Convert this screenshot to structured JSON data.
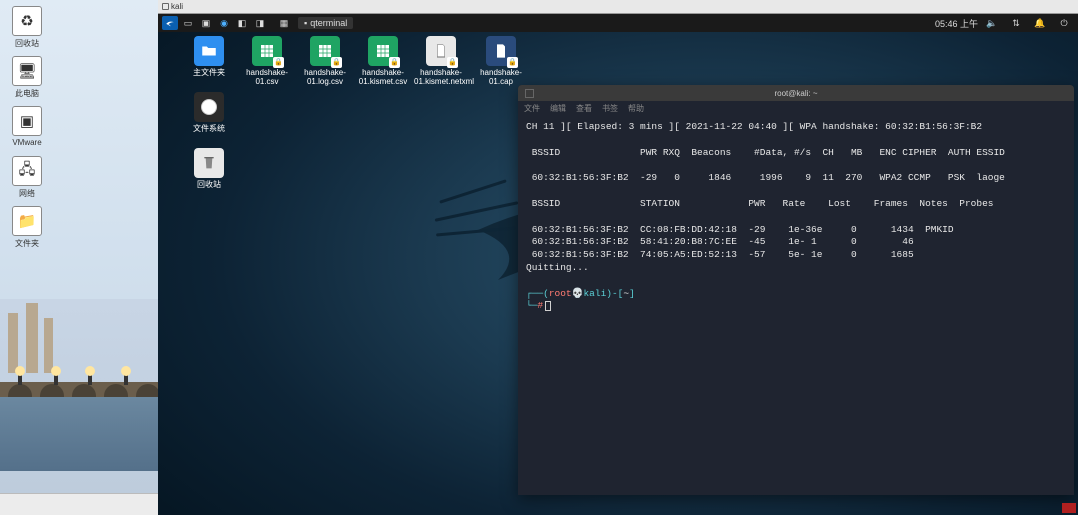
{
  "host": {
    "icons": [
      {
        "label": "回收站"
      },
      {
        "label": "此电脑"
      },
      {
        "label": "VMware"
      },
      {
        "label": "网络"
      },
      {
        "label": "文件夹"
      }
    ]
  },
  "viewer": {
    "title": "kali"
  },
  "panel": {
    "task_label": "qterminal",
    "time": "05:46 上午"
  },
  "desktop_icons": {
    "home": "主文件夹",
    "csv": "handshake-01.csv",
    "logcsv": "handshake-01.log.csv",
    "kismetcsv": "handshake-01.kismet.csv",
    "kismetxml": "handshake-01.kismet.netxml",
    "cap": "handshake-01.cap",
    "fs": "文件系统",
    "trash": "回收站"
  },
  "terminal": {
    "menu": [
      "文件",
      "编辑",
      "查看",
      "书签",
      "帮助"
    ],
    "window_title": "root@kali: ~",
    "summary": "CH 11 ][ Elapsed: 3 mins ][ 2021-11-22 04:40 ][ WPA handshake: 60:32:B1:56:3F:B2",
    "hdr1": " BSSID              PWR RXQ  Beacons    #Data, #/s  CH   MB   ENC CIPHER  AUTH ESSID",
    "row1": " 60:32:B1:56:3F:B2  -29   0     1846     1996    9  11  270   WPA2 CCMP   PSK  laoge",
    "hdr2": " BSSID              STATION            PWR   Rate    Lost    Frames  Notes  Probes",
    "st1": " 60:32:B1:56:3F:B2  CC:08:FB:DD:42:18  -29    1e-36e     0      1434  PMKID",
    "st2": " 60:32:B1:56:3F:B2  58:41:20:B8:7C:EE  -45    1e- 1      0        46",
    "st3": " 60:32:B1:56:3F:B2  74:05:A5:ED:52:13  -57    5e- 1e     0      1685",
    "quitting": "Quitting...",
    "prompt_user": "root",
    "prompt_host": "kali",
    "prompt_path": "~"
  }
}
